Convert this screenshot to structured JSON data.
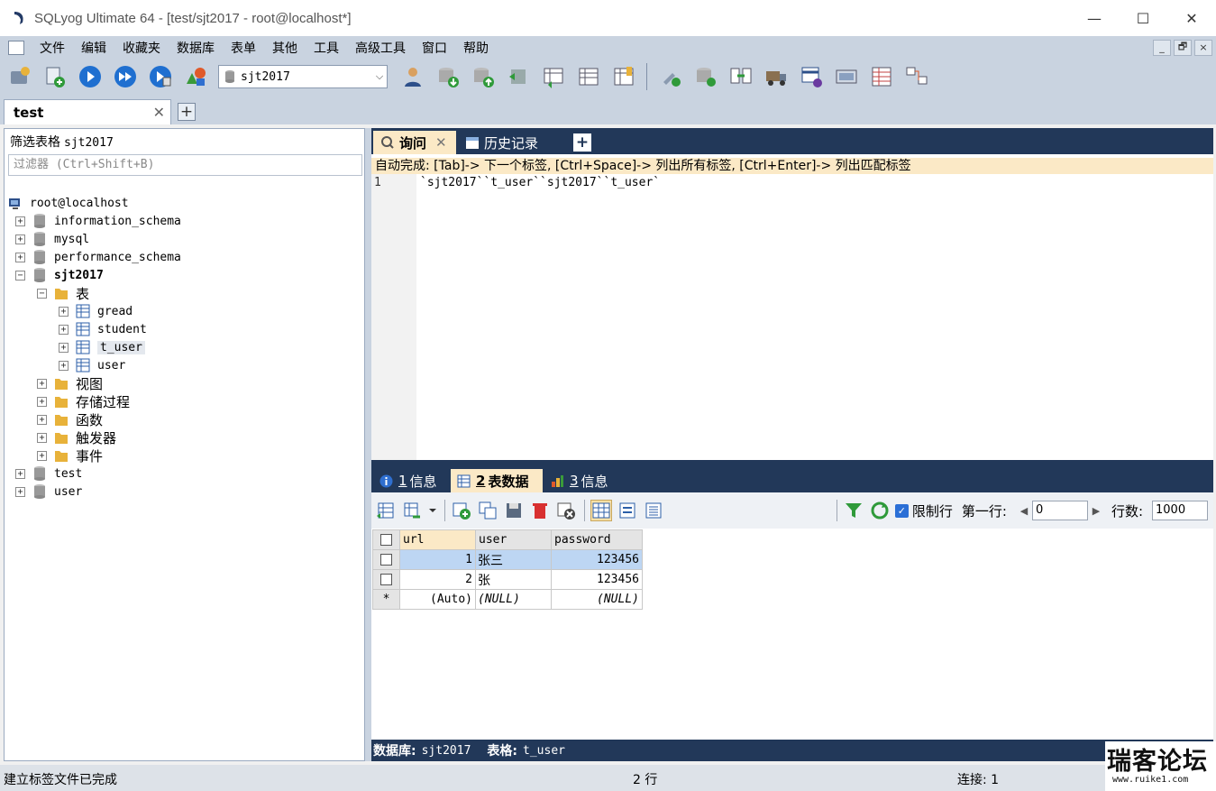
{
  "window": {
    "title": "SQLyog Ultimate 64 - [test/sjt2017 - root@localhost*]",
    "controls": [
      "—",
      "☐",
      "✕"
    ]
  },
  "menu": [
    "文件",
    "编辑",
    "收藏夹",
    "数据库",
    "表单",
    "其他",
    "工具",
    "高级工具",
    "窗口",
    "帮助"
  ],
  "mdi_controls": [
    "_",
    "🗗",
    "×"
  ],
  "toolbar": {
    "database_select": "sjt2017"
  },
  "connection_tab": {
    "label": "test",
    "close": "✕",
    "add": "+"
  },
  "object_browser": {
    "filter_label": "筛选表格",
    "filter_db": "sjt2017",
    "filter_placeholder": "过滤器 (Ctrl+Shift+B)",
    "root": "root@localhost",
    "databases": [
      "information_schema",
      "mysql",
      "performance_schema",
      "sjt2017",
      "test",
      "user"
    ],
    "folders": [
      "表",
      "视图",
      "存储过程",
      "函数",
      "触发器",
      "事件"
    ],
    "tables": [
      "gread",
      "student",
      "t_user",
      "user"
    ],
    "expanded_glyph": "−",
    "collapsed_glyph": "+"
  },
  "query_tabs": {
    "query": "询问",
    "history": "历史记录",
    "close": "✕",
    "add": "+"
  },
  "editor": {
    "autocomplete_hint": "自动完成: [Tab]-> 下一个标签, [Ctrl+Space]-> 列出所有标签, [Ctrl+Enter]-> 列出匹配标签",
    "line_number": "1",
    "code": "`sjt2017``t_user``sjt2017``t_user`"
  },
  "result_tabs": {
    "tab1_num": "1",
    "tab1": "信息",
    "tab2_num": "2",
    "tab2": "表数据",
    "tab3_num": "3",
    "tab3": "信息"
  },
  "result_toolbar": {
    "limit_label": "限制行",
    "first_row_label": "第一行:",
    "first_row_value": "0",
    "rows_label": "行数:",
    "rows_value": "1000",
    "limit_checked": true
  },
  "grid": {
    "columns": [
      "url",
      "user",
      "password"
    ],
    "rows": [
      {
        "url": "1",
        "user": "张三",
        "password": "123456"
      },
      {
        "url": "2",
        "user": "张",
        "password": "123456"
      },
      {
        "url": "(Auto)",
        "user": "(NULL)",
        "password": "(NULL)"
      }
    ],
    "new_row_marker": "*"
  },
  "result_info": {
    "db_label": "数据库:",
    "db_value": "sjt2017",
    "table_label": "表格:",
    "table_value": "t_user"
  },
  "status": {
    "message": "建立标签文件已完成",
    "rows": "2 行",
    "connections": "连接: 1"
  },
  "watermark": {
    "name": "瑞客论坛",
    "url": "www.ruike1.com"
  },
  "colors": {
    "chrome": "#c9d3e0",
    "dark_tab_bar": "#223859",
    "active_tab": "#fbe9c6",
    "selection": "#bdd6f3"
  }
}
